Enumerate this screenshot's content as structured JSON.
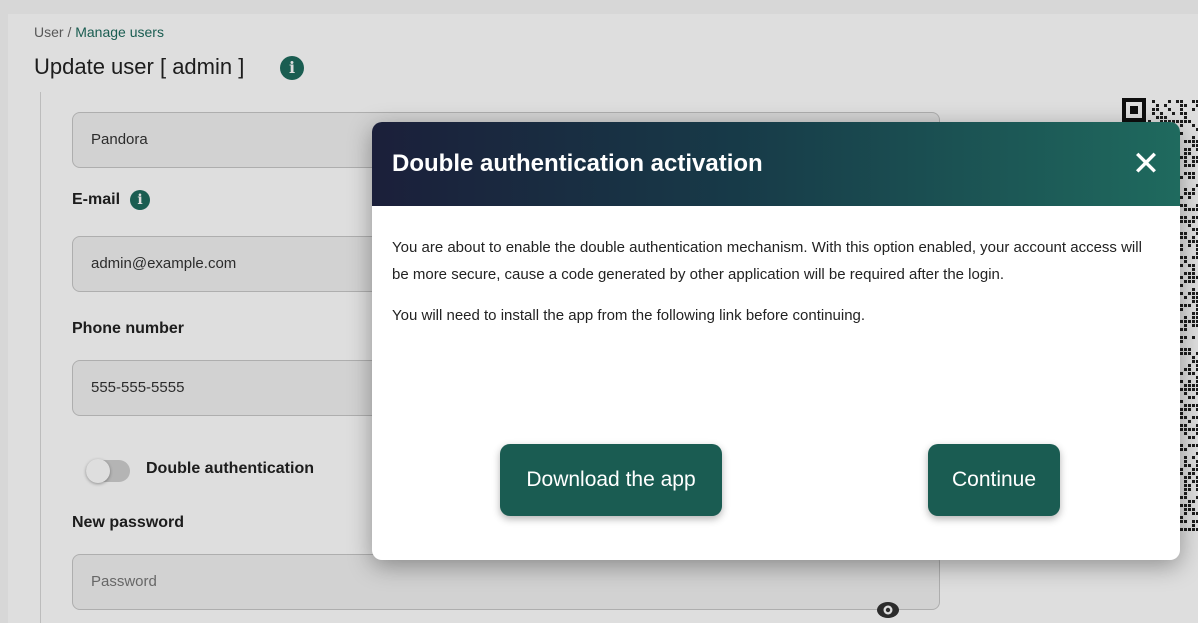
{
  "breadcrumb": {
    "parent": "User",
    "separator": " / ",
    "current": "Manage users"
  },
  "page": {
    "title": "Update user [ admin ]"
  },
  "form": {
    "fullname_value": "Pandora",
    "email_label": "E-mail",
    "email_value": "admin@example.com",
    "phone_label": "Phone number",
    "phone_value": "555-555-5555",
    "double_auth_label": "Double authentication",
    "double_auth_enabled": false,
    "new_password_label": "New password",
    "new_password_placeholder": "Password"
  },
  "modal": {
    "title": "Double authentication activation",
    "close_glyph": "✕",
    "paragraph1": "You are about to enable the double authentication mechanism. With this option enabled, your account access will be more secure, cause a code generated by other application will be required after the login.",
    "paragraph2": "You will need to install the app from the following link before continuing.",
    "download_label": "Download the app",
    "continue_label": "Continue"
  },
  "icons": {
    "info": "info-icon",
    "eye": "eye-icon",
    "close": "close-icon",
    "qr": "qr-code"
  },
  "colors": {
    "accent": "#1e6b5e",
    "button": "#1a5c52",
    "header_dark": "#1b1f3a",
    "header_teal": "#1f6a5e"
  }
}
